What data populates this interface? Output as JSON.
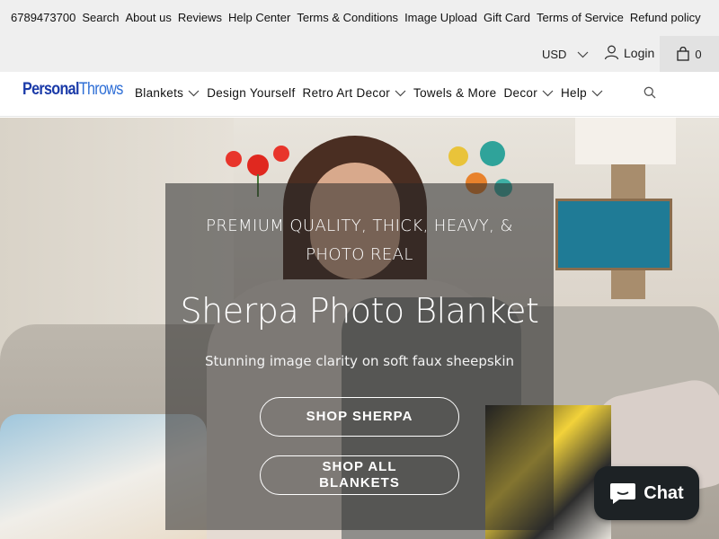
{
  "topbar": {
    "links": [
      "6789473700",
      "Search",
      "About us",
      "Reviews",
      "Help Center",
      "Terms & Conditions",
      "Image Upload",
      "Gift Card",
      "Terms of Service",
      "Refund policy"
    ]
  },
  "utility": {
    "currency": "USD",
    "login_label": "Login",
    "cart_count": "0"
  },
  "header": {
    "logo_part1": "Personal",
    "logo_part2": "Throws",
    "menu": [
      {
        "label": "Blankets",
        "has_dropdown": true
      },
      {
        "label": "Design Yourself",
        "has_dropdown": false
      },
      {
        "label": "Retro Art Decor",
        "has_dropdown": true
      },
      {
        "label": "Towels & More",
        "has_dropdown": false
      },
      {
        "label": "Decor",
        "has_dropdown": true
      },
      {
        "label": "Help",
        "has_dropdown": true
      }
    ]
  },
  "hero": {
    "kicker": "PREMIUM QUALITY, THICK, HEAVY, & PHOTO REAL",
    "title": "Sherpa Photo Blanket",
    "subtitle": "Stunning image clarity on soft faux sheepskin",
    "button_primary": "SHOP SHERPA",
    "button_secondary": "SHOP ALL BLANKETS"
  },
  "chat": {
    "label": "Chat"
  },
  "colors": {
    "topbar_bg": "#efefef",
    "logo_dark_blue": "#1a3aa8",
    "logo_light_blue": "#2f6fd6",
    "chat_bg": "#1d2225"
  }
}
